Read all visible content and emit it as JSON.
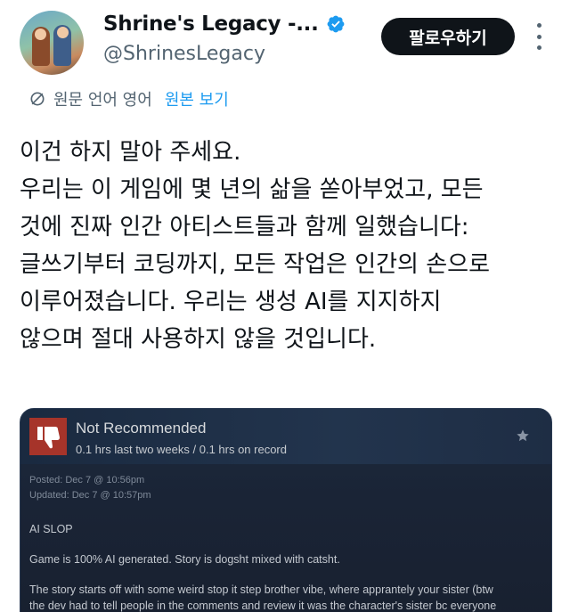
{
  "header": {
    "display_name": "Shrine's Legacy -...",
    "handle": "@ShrinesLegacy",
    "follow_label": "팔로우하기",
    "verified_color": "#1d9bf0"
  },
  "translation": {
    "label": "원문 언어 영어",
    "link": "원본 보기",
    "icon": "translate-icon"
  },
  "tweet": {
    "lines": [
      "이건 하지 말아 주세요.",
      "우리는 이 게임에 몇 년의 삶을 쏟아부었고, 모든",
      "것에 진짜 인간 아티스트들과 함께 일했습니다:",
      "글쓰기부터 코딩까지, 모든 작업은 인간의 손으로",
      "이루어졌습니다. 우리는 생성 AI를 지지하지",
      "않으며 절대 사용하지 않을 것입니다."
    ]
  },
  "review": {
    "verdict": "Not Recommended",
    "hours": "0.1 hrs last two weeks / 0.1 hrs on record",
    "posted": "Posted: Dec 7 @ 10:56pm",
    "updated": "Updated: Dec 7 @ 10:57pm",
    "body": [
      "AI SLOP",
      "Game is 100% AI generated. Story is dogsht mixed with catsht.",
      "The story starts off with some weird stop it step brother vibe, where apprantely your sister (btw",
      "the dev had to tell people in the comments and review it was the character's sister bc everyone"
    ],
    "thumb_color": "#a6342a"
  }
}
